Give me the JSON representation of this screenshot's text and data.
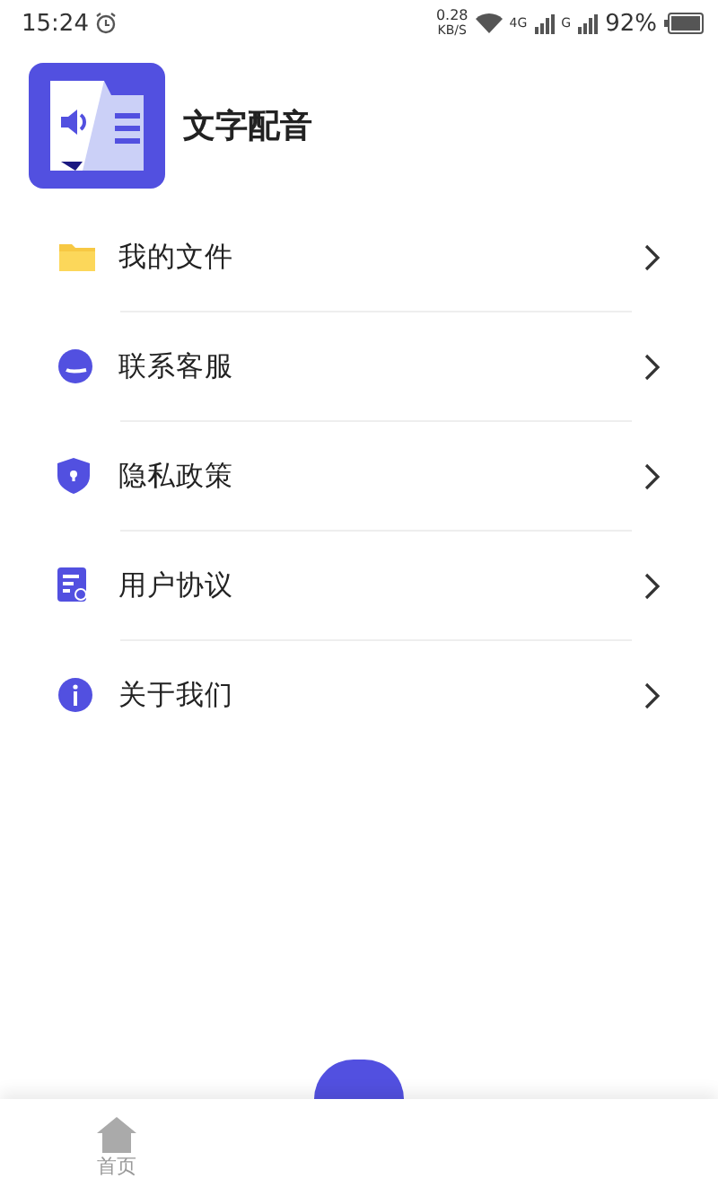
{
  "status_bar": {
    "time": "15:24",
    "speed": "0.28",
    "speed_unit": "KB/S",
    "network_1": "4G",
    "network_2": "G",
    "battery": "92%"
  },
  "app": {
    "name": "文字配音"
  },
  "menu": [
    {
      "kind": "folder",
      "label": "我的文件"
    },
    {
      "kind": "service",
      "label": "联系客服"
    },
    {
      "kind": "privacy",
      "label": "隐私政策"
    },
    {
      "kind": "agreement",
      "label": "用户协议"
    },
    {
      "kind": "about",
      "label": "关于我们"
    }
  ],
  "bottom_nav": {
    "tabs": [
      {
        "label": "首页",
        "selected": false
      }
    ]
  }
}
